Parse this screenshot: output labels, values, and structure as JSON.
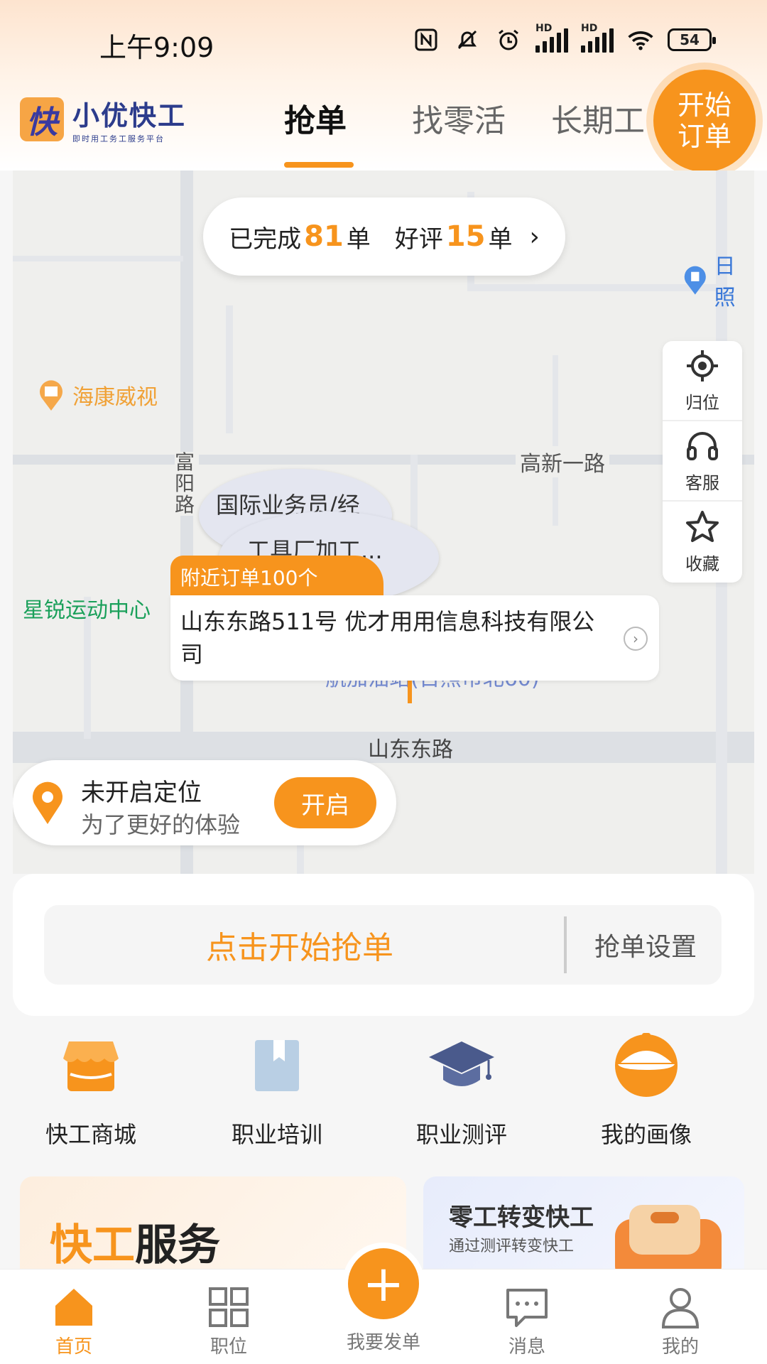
{
  "status_bar": {
    "time": "上午9:09",
    "battery": "54"
  },
  "header": {
    "logo_mark": "快",
    "logo_title": "小优快工",
    "logo_subtitle": "即时用工务工服务平台",
    "tabs": [
      {
        "label": "抢单"
      },
      {
        "label": "找零活"
      },
      {
        "label": "长期工"
      }
    ],
    "start_order": "开始订单"
  },
  "map": {
    "stats": {
      "prefix": "已完成",
      "completed": "81",
      "unit1": "单",
      "good_prefix": "好评",
      "good": "15",
      "unit2": "单"
    },
    "labels": {
      "haikang": "海康威视",
      "gaoxin": "高新一路",
      "fuyang": "富阳路",
      "xingrui": "星锐运动中心",
      "shandong_road": "山东东路",
      "rizhao": "日照",
      "gas": "航加油站(日照市北60)"
    },
    "bubbles": {
      "job1": "国际业务员/经",
      "job2": "工具厂加工..."
    },
    "nearby_tag": "附近订单100个",
    "address": "山东东路511号 优才用用信息科技有限公司",
    "tools": [
      {
        "label": "归位",
        "icon": "locate-icon"
      },
      {
        "label": "客服",
        "icon": "headset-icon"
      },
      {
        "label": "收藏",
        "icon": "star-icon"
      }
    ],
    "location": {
      "title": "未开启定位",
      "subtitle": "为了更好的体验",
      "button": "开启"
    }
  },
  "grab": {
    "main": "点击开始抢单",
    "settings": "抢单设置"
  },
  "shortcuts": [
    {
      "label": "快工商城",
      "icon": "shop-icon"
    },
    {
      "label": "职业培训",
      "icon": "book-icon"
    },
    {
      "label": "职业测评",
      "icon": "graduation-cap-icon"
    },
    {
      "label": "我的画像",
      "icon": "helmet-icon"
    }
  ],
  "promos": {
    "left": {
      "title_orange": "快工",
      "title_dark": "服务"
    },
    "right": {
      "title": "零工转变快工",
      "subtitle": "通过测评转变快工"
    }
  },
  "bottom_nav": [
    {
      "label": "首页"
    },
    {
      "label": "职位"
    },
    {
      "label": "我要发单"
    },
    {
      "label": "消息"
    },
    {
      "label": "我的"
    }
  ],
  "colors": {
    "accent": "#f7941d",
    "brand_blue": "#2c3c8c"
  }
}
